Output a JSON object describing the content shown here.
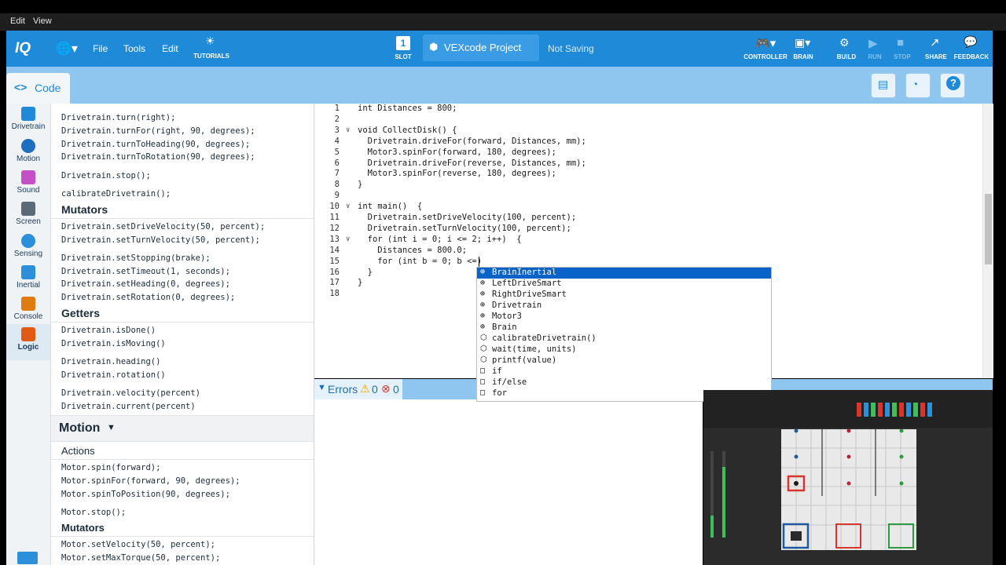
{
  "os_menu": {
    "edit": "Edit",
    "view": "View"
  },
  "topbar": {
    "logo": "IQ",
    "file": "File",
    "tools": "Tools",
    "edit": "Edit",
    "tutorials": "TUTORIALS",
    "slot_number": "1",
    "slot": "SLOT",
    "project_name": "VEXcode Project",
    "status": "Not Saving",
    "controller": "CONTROLLER",
    "brain": "BRAIN",
    "build": "BUILD",
    "run": "RUN",
    "stop": "STOP",
    "share": "SHARE",
    "feedback": "FEEDBACK"
  },
  "code_tab": "Code",
  "categories": [
    "Drivetrain",
    "Motion",
    "Sound",
    "Screen",
    "Sensing",
    "Inertial",
    "Console",
    "Logic"
  ],
  "colors": {
    "accent": "#1f8ad8",
    "band": "#8fc6f0",
    "selection": "#0a63c8"
  },
  "toolbox": {
    "drive_lines": [
      "Drivetrain.turn(right);",
      "Drivetrain.turnFor(right, 90, degrees);",
      "Drivetrain.turnToHeading(90, degrees);",
      "Drivetrain.turnToRotation(90, degrees);",
      "Drivetrain.stop();",
      "calibrateDrivetrain();"
    ],
    "mutators_title": "Mutators",
    "mutator_lines": [
      "Drivetrain.setDriveVelocity(50, percent);",
      "Drivetrain.setTurnVelocity(50, percent);",
      "Drivetrain.setStopping(brake);",
      "Drivetrain.setTimeout(1, seconds);",
      "Drivetrain.setHeading(0, degrees);",
      "Drivetrain.setRotation(0, degrees);"
    ],
    "getters_title": "Getters",
    "getter_lines": [
      "Drivetrain.isDone()",
      "Drivetrain.isMoving()",
      "Drivetrain.heading()",
      "Drivetrain.rotation()",
      "Drivetrain.velocity(percent)",
      "Drivetrain.current(percent)"
    ],
    "motion_header": "Motion",
    "actions_title": "Actions",
    "action_lines": [
      "Motor.spin(forward);",
      "Motor.spinFor(forward, 90, degrees);",
      "Motor.spinToPosition(90, degrees);",
      "Motor.stop();"
    ],
    "mutators2_title": "Mutators",
    "mutator2_lines": [
      "Motor.setVelocity(50, percent);",
      "Motor.setMaxTorque(50, percent);"
    ]
  },
  "editor": {
    "line_numbers": [
      "1",
      "2",
      "3",
      "4",
      "5",
      "6",
      "7",
      "8",
      "9",
      "10",
      "11",
      "12",
      "13",
      "14",
      "15",
      "16",
      "17",
      "18"
    ],
    "lines": [
      "int Distances = 800;",
      "",
      "void CollectDisk() {",
      "  Drivetrain.driveFor(forward, Distances, mm);",
      "  Motor3.spinFor(forward, 180, degrees);",
      "  Drivetrain.driveFor(reverse, Distances, mm);",
      "  Motor3.spinFor(reverse, 180, degrees);",
      "}",
      "",
      "int main()  {",
      "  Drivetrain.setDriveVelocity(100, percent);",
      "  Drivetrain.setTurnVelocity(100, percent);",
      "  for (int i = 0; i <= 2; i++)  {",
      "    Distances = 800.0;",
      "    for (int b = 0; b <=)",
      "  }",
      "}",
      ""
    ]
  },
  "autocomplete": [
    "BrainInertial",
    "LeftDriveSmart",
    "RightDriveSmart",
    "Drivetrain",
    "Motor3",
    "Brain",
    "calibrateDrivetrain()",
    "wait(time, units)",
    "printf(value)",
    "if",
    "if/else",
    "for"
  ],
  "errors": {
    "label": "Errors",
    "warnings": "0",
    "errors": "0"
  }
}
